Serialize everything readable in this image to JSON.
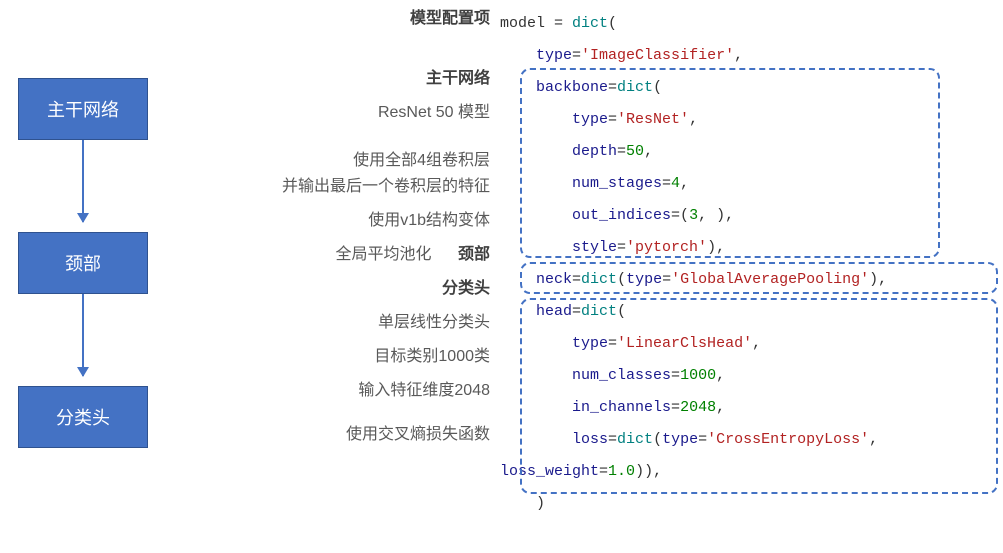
{
  "flow": {
    "backbone": "主干网络",
    "neck": "颈部",
    "head": "分类头"
  },
  "ann": {
    "model_cfg": "模型配置项",
    "backbone_title": "主干网络",
    "resnet50": "ResNet 50 模型",
    "stages": "使用全部4组卷积层",
    "out_indices": "并输出最后一个卷积层的特征",
    "style": "使用v1b结构变体",
    "gap": "全局平均池化",
    "neck_title": "颈部",
    "head_title": "分类头",
    "linear_head": "单层线性分类头",
    "num_classes": "目标类别1000类",
    "in_channels": "输入特征维度2048",
    "loss": "使用交叉熵损失函数"
  },
  "code": {
    "l1a": "model = ",
    "l1b": "dict",
    "l1c": "(",
    "l2a": "    ",
    "l2b": "type",
    "l2c": "=",
    "l2d": "'ImageClassifier'",
    "l2e": ",",
    "l3a": "    ",
    "l3b": "backbone",
    "l3c": "=",
    "l3d": "dict",
    "l3e": "(",
    "l4a": "        ",
    "l4b": "type",
    "l4c": "=",
    "l4d": "'ResNet'",
    "l4e": ",",
    "l5a": "        ",
    "l5b": "depth",
    "l5c": "=",
    "l5d": "50",
    "l5e": ",",
    "l6a": "        ",
    "l6b": "num_stages",
    "l6c": "=",
    "l6d": "4",
    "l6e": ",",
    "l7a": "        ",
    "l7b": "out_indices",
    "l7c": "=(",
    "l7d": "3",
    "l7e": ", ),",
    "l8a": "        ",
    "l8b": "style",
    "l8c": "=",
    "l8d": "'pytorch'",
    "l8e": "),",
    "l9a": "    ",
    "l9b": "neck",
    "l9c": "=",
    "l9d": "dict",
    "l9e": "(",
    "l9f": "type",
    "l9g": "=",
    "l9h": "'GlobalAveragePooling'",
    "l9i": "),",
    "l10a": "    ",
    "l10b": "head",
    "l10c": "=",
    "l10d": "dict",
    "l10e": "(",
    "l11a": "        ",
    "l11b": "type",
    "l11c": "=",
    "l11d": "'LinearClsHead'",
    "l11e": ",",
    "l12a": "        ",
    "l12b": "num_classes",
    "l12c": "=",
    "l12d": "1000",
    "l12e": ",",
    "l13a": "        ",
    "l13b": "in_channels",
    "l13c": "=",
    "l13d": "2048",
    "l13e": ",",
    "l14a": "        ",
    "l14b": "loss",
    "l14c": "=",
    "l14d": "dict",
    "l14e": "(",
    "l14f": "type",
    "l14g": "=",
    "l14h": "'CrossEntropyLoss'",
    "l14i": ",",
    "l15a": "",
    "l15b": "loss_weight",
    "l15c": "=",
    "l15d": "1.0",
    "l15e": ")),",
    "l16a": "    )"
  },
  "chart_data": {
    "type": "diagram",
    "flow": [
      "主干网络",
      "颈部",
      "分类头"
    ],
    "model": {
      "type": "ImageClassifier",
      "backbone": {
        "type": "ResNet",
        "depth": 50,
        "num_stages": 4,
        "out_indices": [
          3
        ],
        "style": "pytorch"
      },
      "neck": {
        "type": "GlobalAveragePooling"
      },
      "head": {
        "type": "LinearClsHead",
        "num_classes": 1000,
        "in_channels": 2048,
        "loss": {
          "type": "CrossEntropyLoss",
          "loss_weight": 1.0
        }
      }
    }
  }
}
